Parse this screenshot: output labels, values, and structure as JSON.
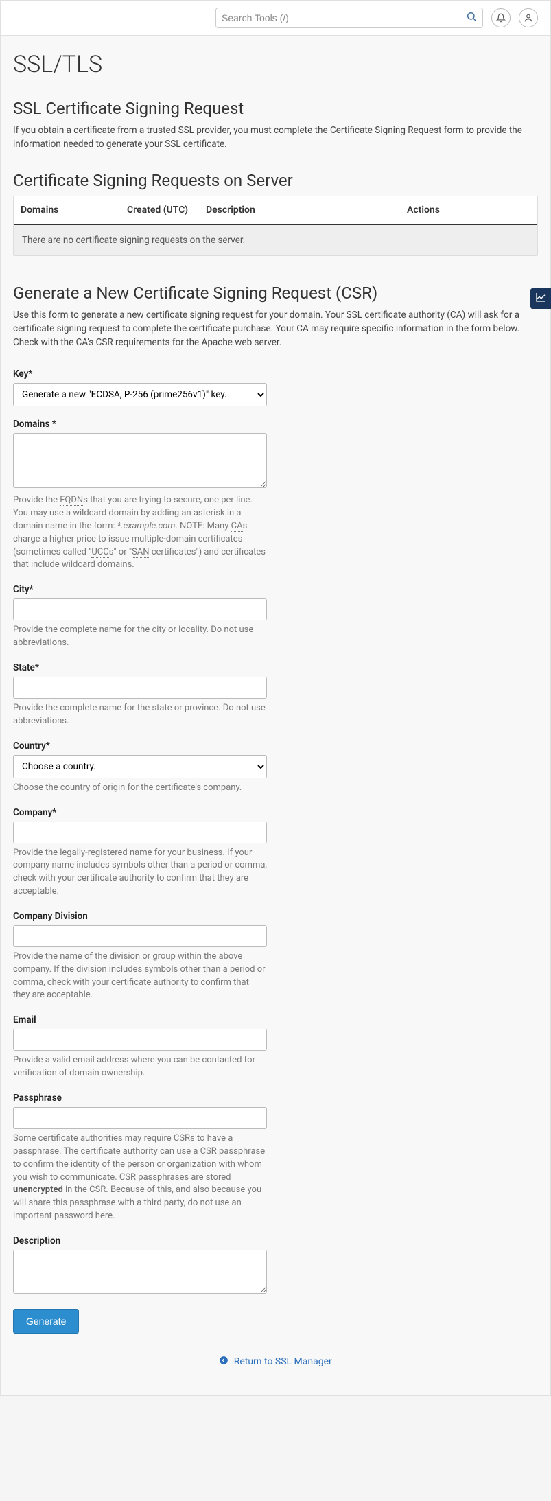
{
  "topbar": {
    "search_placeholder": "Search Tools (/)"
  },
  "page_title": "SSL/TLS",
  "section_csr_heading": "SSL Certificate Signing Request",
  "section_csr_intro": "If you obtain a certificate from a trusted SSL provider, you must complete the Certificate Signing Request form to provide the information needed to generate your SSL certificate.",
  "table_heading": "Certificate Signing Requests on Server",
  "table": {
    "columns": {
      "domains": "Domains",
      "created": "Created (UTC)",
      "description": "Description",
      "actions": "Actions"
    },
    "empty_text": "There are no certificate signing requests on the server."
  },
  "gen_heading": "Generate a New Certificate Signing Request (CSR)",
  "gen_intro": "Use this form to generate a new certificate signing request for your domain. Your SSL certificate authority (CA) will ask for a certificate signing request to complete the certificate purchase. Your CA may require specific information in the form below. Check with the CA's CSR requirements for the Apache web server.",
  "form": {
    "key": {
      "label": "Key*",
      "selected": "Generate a new \"ECDSA, P-256 (prime256v1)\" key."
    },
    "domains": {
      "label": "Domains *",
      "help_pre": "Provide the ",
      "help_fqdn": "FQDN",
      "help_mid1": "s that you are trying to secure, one per line. You may use a wildcard domain by adding an asterisk in a domain name in the form: ",
      "help_example": "*.example.com",
      "help_mid2": ". NOTE: Many ",
      "help_ca": "CA",
      "help_mid3": "s charge a higher price to issue multiple-domain certificates (sometimes called \"",
      "help_ucc": "UCC",
      "help_mid4": "s\" or \"",
      "help_san": "SAN",
      "help_post": " certificates\") and certificates that include wildcard domains."
    },
    "city": {
      "label": "City*",
      "help": "Provide the complete name for the city or locality. Do not use abbreviations."
    },
    "state": {
      "label": "State*",
      "help": "Provide the complete name for the state or province. Do not use abbreviations."
    },
    "country": {
      "label": "Country*",
      "selected": "Choose a country.",
      "help": "Choose the country of origin for the certificate's company."
    },
    "company": {
      "label": "Company*",
      "help": "Provide the legally-registered name for your business. If your company name includes symbols other than a period or comma, check with your certificate authority to confirm that they are acceptable."
    },
    "division": {
      "label": "Company Division",
      "help": "Provide the name of the division or group within the above company. If the division includes symbols other than a period or comma, check with your certificate authority to confirm that they are acceptable."
    },
    "email": {
      "label": "Email",
      "help": "Provide a valid email address where you can be contacted for verification of domain ownership."
    },
    "passphrase": {
      "label": "Passphrase",
      "help_pre": "Some certificate authorities may require CSRs to have a passphrase. The certificate authority can use a CSR passphrase to confirm the identity of the person or organization with whom you wish to communicate. CSR passphrases are stored ",
      "help_strong": "unencrypted",
      "help_post": " in the CSR. Because of this, and also because you will share this passphrase with a third party, do not use an important password here."
    },
    "description": {
      "label": "Description"
    },
    "submit_label": "Generate"
  },
  "return_link": "Return to SSL Manager"
}
